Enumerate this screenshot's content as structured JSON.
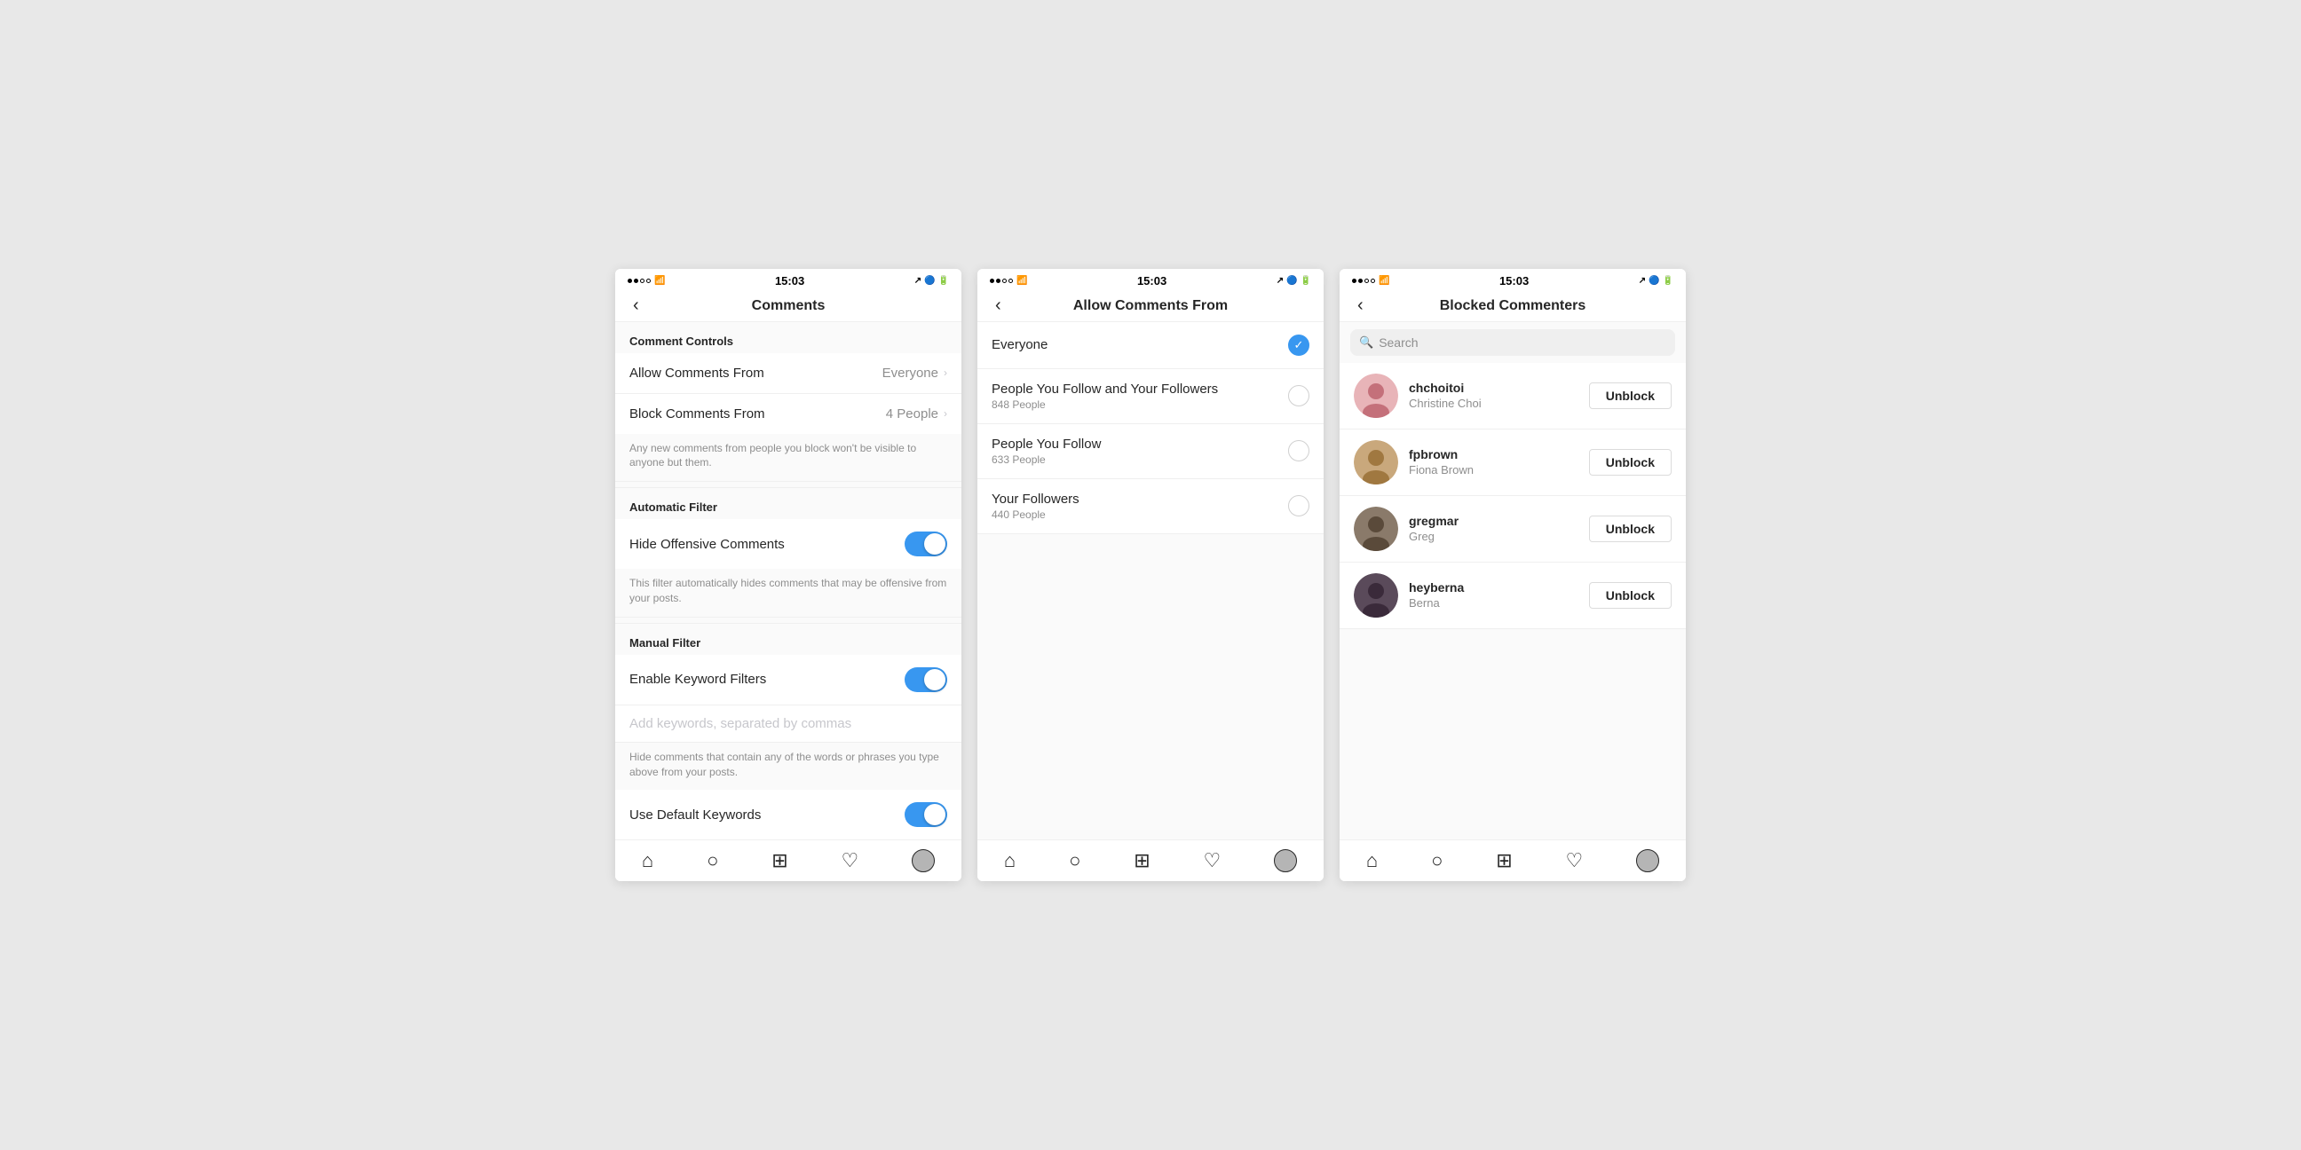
{
  "statusBar": {
    "time": "15:03"
  },
  "screen1": {
    "title": "Comments",
    "sections": {
      "commentControls": {
        "header": "Comment Controls",
        "allowCommentsFrom": {
          "label": "Allow Comments From",
          "value": "Everyone"
        },
        "blockCommentsFrom": {
          "label": "Block Comments From",
          "value": "4 People"
        },
        "helperText": "Any new comments from people you block won't be visible to anyone but them."
      },
      "automaticFilter": {
        "header": "Automatic Filter",
        "hideOffensive": {
          "label": "Hide Offensive Comments",
          "toggleOn": true
        },
        "helperText": "This filter automatically hides comments that may be offensive from your posts."
      },
      "manualFilter": {
        "header": "Manual Filter",
        "enableKeyword": {
          "label": "Enable Keyword Filters",
          "toggleOn": true
        },
        "keywordPlaceholder": "Add keywords, separated by commas",
        "helperText": "Hide comments that contain any of the words or phrases you type above from your posts.",
        "useDefaultKeywords": {
          "label": "Use Default Keywords",
          "toggleOn": true
        }
      }
    }
  },
  "screen2": {
    "title": "Allow Comments From",
    "options": [
      {
        "label": "Everyone",
        "sub": "",
        "selected": true
      },
      {
        "label": "People You Follow and Your Followers",
        "sub": "848 People",
        "selected": false
      },
      {
        "label": "People You Follow",
        "sub": "633 People",
        "selected": false
      },
      {
        "label": "Your Followers",
        "sub": "440 People",
        "selected": false
      }
    ]
  },
  "screen3": {
    "title": "Blocked Commenters",
    "searchPlaceholder": "Search",
    "blockedUsers": [
      {
        "handle": "chchoitoi",
        "name": "Christine Choi",
        "avatarColor": "#e8b4b8"
      },
      {
        "handle": "fpbrown",
        "name": "Fiona Brown",
        "avatarColor": "#c9a87c"
      },
      {
        "handle": "gregmar",
        "name": "Greg",
        "avatarColor": "#8a7a6a"
      },
      {
        "handle": "heyberna",
        "name": "Berna",
        "avatarColor": "#5a4a5a"
      }
    ],
    "unblockLabel": "Unblock"
  },
  "tabBar": {
    "icons": [
      "home",
      "search",
      "add",
      "heart",
      "profile"
    ]
  }
}
